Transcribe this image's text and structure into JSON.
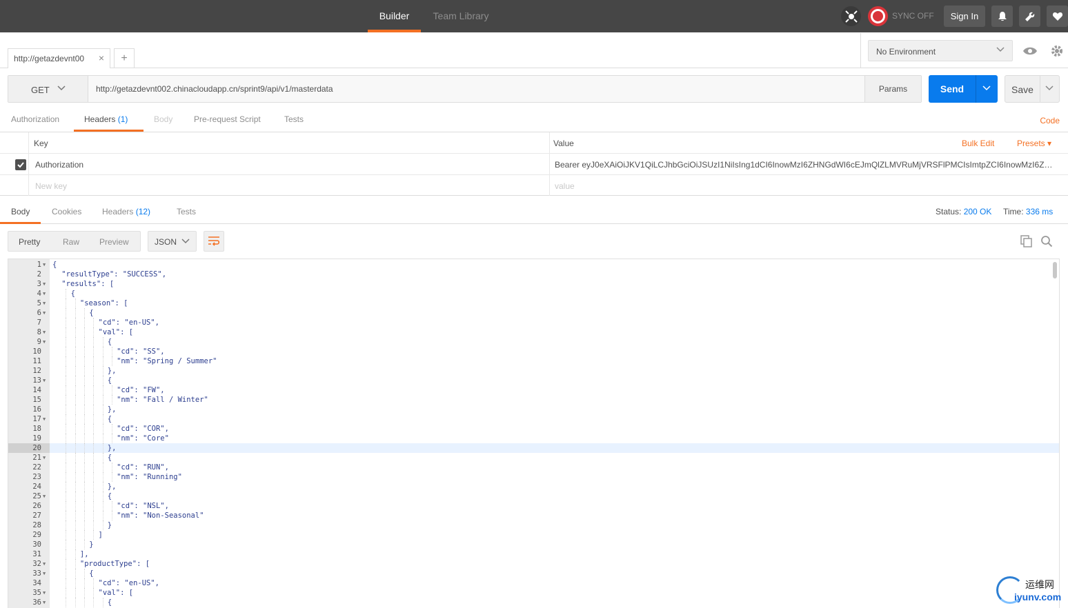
{
  "topbar": {
    "tabs": [
      {
        "label": "Builder",
        "active": true
      },
      {
        "label": "Team Library",
        "active": false
      }
    ],
    "sync_label": "SYNC OFF",
    "signin_label": "Sign In",
    "accent_color": "#f47023"
  },
  "request_tabs": [
    {
      "label": "http://getazdevnt00"
    }
  ],
  "environment": {
    "selected": "No Environment"
  },
  "request": {
    "method": "GET",
    "url": "http://getazdevnt002.chinacloudapp.cn/sprint9/api/v1/masterdata",
    "params_label": "Params",
    "send_label": "Send",
    "save_label": "Save"
  },
  "request_sub_tabs": {
    "authorization": "Authorization",
    "headers": "Headers",
    "headers_count": "(1)",
    "body": "Body",
    "prerequest": "Pre-request Script",
    "tests": "Tests",
    "code": "Code"
  },
  "headers_table": {
    "key_header": "Key",
    "value_header": "Value",
    "bulk_edit": "Bulk Edit",
    "presets": "Presets",
    "rows": [
      {
        "key": "Authorization",
        "value": "Bearer eyJ0eXAiOiJKV1QiLCJhbGciOiJSUzI1NiIsIng1dCI6InowMzI6ZHNGdWI6cEJmQlZLMVRuMjVRSFlPMCIsImtpZCI6InowMzI6ZHNG...",
        "checked": true
      }
    ],
    "new_key_placeholder": "New key",
    "new_value_placeholder": "value"
  },
  "response_tabs": {
    "body": "Body",
    "cookies": "Cookies",
    "headers": "Headers",
    "headers_count": "(12)",
    "tests": "Tests",
    "status_label": "Status:",
    "status_value": "200 OK",
    "time_label": "Time:",
    "time_value": "336 ms"
  },
  "response_toolbar": {
    "pretty": "Pretty",
    "raw": "Raw",
    "preview": "Preview",
    "format": "JSON"
  },
  "code_lines": [
    {
      "n": "1",
      "fold": true,
      "indent": 0,
      "text": "{"
    },
    {
      "n": "2",
      "fold": false,
      "indent": 1,
      "text": "\"resultType\": \"SUCCESS\","
    },
    {
      "n": "3",
      "fold": true,
      "indent": 1,
      "text": "\"results\": ["
    },
    {
      "n": "4",
      "fold": true,
      "indent": 2,
      "text": "{"
    },
    {
      "n": "5",
      "fold": true,
      "indent": 3,
      "text": "\"season\": ["
    },
    {
      "n": "6",
      "fold": true,
      "indent": 4,
      "text": "{"
    },
    {
      "n": "7",
      "fold": false,
      "indent": 5,
      "text": "\"cd\": \"en-US\","
    },
    {
      "n": "8",
      "fold": true,
      "indent": 5,
      "text": "\"val\": ["
    },
    {
      "n": "9",
      "fold": true,
      "indent": 6,
      "text": "{"
    },
    {
      "n": "10",
      "fold": false,
      "indent": 7,
      "text": "\"cd\": \"SS\","
    },
    {
      "n": "11",
      "fold": false,
      "indent": 7,
      "text": "\"nm\": \"Spring / Summer\""
    },
    {
      "n": "12",
      "fold": false,
      "indent": 6,
      "text": "},"
    },
    {
      "n": "13",
      "fold": true,
      "indent": 6,
      "text": "{"
    },
    {
      "n": "14",
      "fold": false,
      "indent": 7,
      "text": "\"cd\": \"FW\","
    },
    {
      "n": "15",
      "fold": false,
      "indent": 7,
      "text": "\"nm\": \"Fall / Winter\""
    },
    {
      "n": "16",
      "fold": false,
      "indent": 6,
      "text": "},"
    },
    {
      "n": "17",
      "fold": true,
      "indent": 6,
      "text": "{"
    },
    {
      "n": "18",
      "fold": false,
      "indent": 7,
      "text": "\"cd\": \"COR\","
    },
    {
      "n": "19",
      "fold": false,
      "indent": 7,
      "text": "\"nm\": \"Core\""
    },
    {
      "n": "20",
      "fold": false,
      "indent": 6,
      "text": "},",
      "highlight": true
    },
    {
      "n": "21",
      "fold": true,
      "indent": 6,
      "text": "{"
    },
    {
      "n": "22",
      "fold": false,
      "indent": 7,
      "text": "\"cd\": \"RUN\","
    },
    {
      "n": "23",
      "fold": false,
      "indent": 7,
      "text": "\"nm\": \"Running\""
    },
    {
      "n": "24",
      "fold": false,
      "indent": 6,
      "text": "},"
    },
    {
      "n": "25",
      "fold": true,
      "indent": 6,
      "text": "{"
    },
    {
      "n": "26",
      "fold": false,
      "indent": 7,
      "text": "\"cd\": \"NSL\","
    },
    {
      "n": "27",
      "fold": false,
      "indent": 7,
      "text": "\"nm\": \"Non-Seasonal\""
    },
    {
      "n": "28",
      "fold": false,
      "indent": 6,
      "text": "}"
    },
    {
      "n": "29",
      "fold": false,
      "indent": 5,
      "text": "]"
    },
    {
      "n": "30",
      "fold": false,
      "indent": 4,
      "text": "}"
    },
    {
      "n": "31",
      "fold": false,
      "indent": 3,
      "text": "],"
    },
    {
      "n": "32",
      "fold": true,
      "indent": 3,
      "text": "\"productType\": ["
    },
    {
      "n": "33",
      "fold": true,
      "indent": 4,
      "text": "{"
    },
    {
      "n": "34",
      "fold": false,
      "indent": 5,
      "text": "\"cd\": \"en-US\","
    },
    {
      "n": "35",
      "fold": true,
      "indent": 5,
      "text": "\"val\": ["
    },
    {
      "n": "36",
      "fold": true,
      "indent": 6,
      "text": "{"
    }
  ],
  "watermark": {
    "cn": "运维网",
    "en": "iyunv.com"
  }
}
